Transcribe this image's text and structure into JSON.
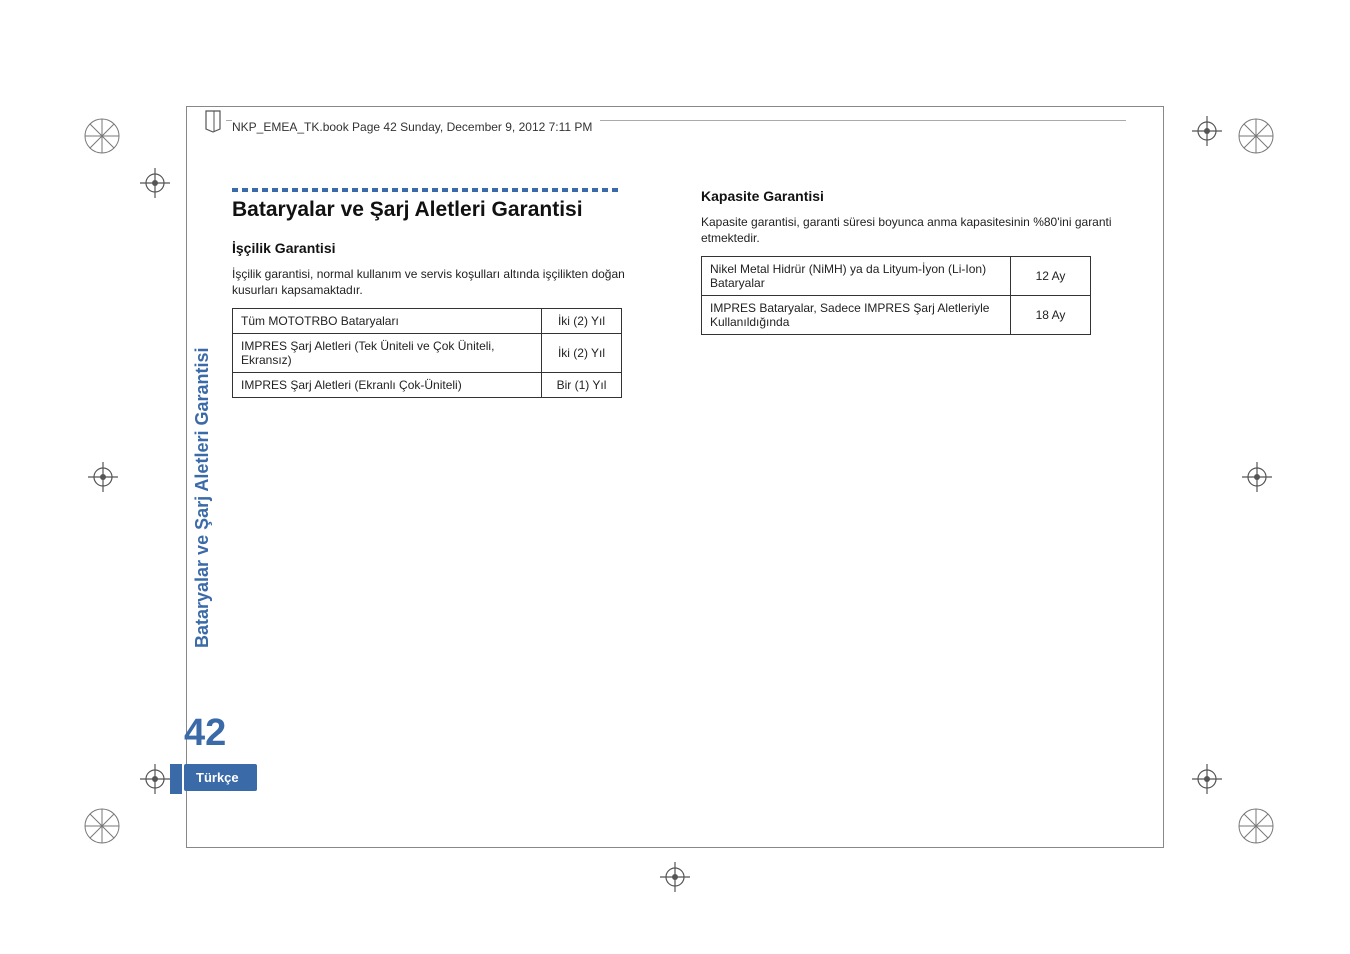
{
  "header": {
    "running_head": "NKP_EMEA_TK.book  Page 42  Sunday, December 9, 2012  7:11 PM"
  },
  "sidebar": {
    "label": "Bataryalar ve Şarj Aletleri Garantisi"
  },
  "page_number": "42",
  "language_tab": "Türkçe",
  "left": {
    "title": "Bataryalar ve Şarj Aletleri Garantisi",
    "subhead": "İşçilik Garantisi",
    "body": "İşçilik garantisi, normal kullanım ve servis koşulları altında işçilikten doğan kusurları kapsamaktadır.",
    "rows": [
      {
        "item": "Tüm MOTOTRBO Bataryaları",
        "term": "İki (2) Yıl"
      },
      {
        "item": "IMPRES Şarj Aletleri (Tek Üniteli ve Çok Üniteli, Ekransız)",
        "term": "İki (2) Yıl"
      },
      {
        "item": "IMPRES Şarj Aletleri (Ekranlı Çok-Üniteli)",
        "term": "Bir (1) Yıl"
      }
    ]
  },
  "right": {
    "subhead": "Kapasite Garantisi",
    "body": "Kapasite garantisi, garanti süresi boyunca anma kapasitesinin %80'ini garanti etmektedir.",
    "rows": [
      {
        "item": "Nikel Metal Hidrür (NiMH) ya da Lityum-İyon (Li-Ion) Bataryalar",
        "term": "12 Ay"
      },
      {
        "item": "IMPRES Bataryalar, Sadece IMPRES Şarj Aletleriyle Kullanıldığında",
        "term": "18 Ay"
      }
    ]
  }
}
